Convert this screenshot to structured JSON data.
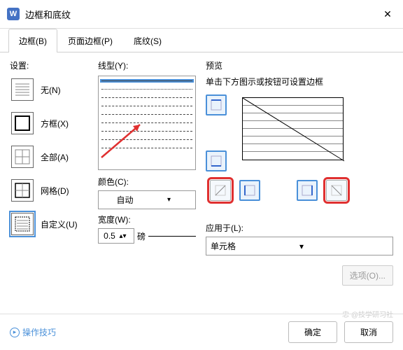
{
  "window": {
    "title": "边框和底纹",
    "app_letter": "W"
  },
  "tabs": [
    {
      "label": "边框(B)",
      "active": true
    },
    {
      "label": "页面边框(P)",
      "active": false
    },
    {
      "label": "底纹(S)",
      "active": false
    }
  ],
  "settings": {
    "label": "设置:",
    "items": [
      {
        "label": "无(N)",
        "id": "none"
      },
      {
        "label": "方框(X)",
        "id": "box"
      },
      {
        "label": "全部(A)",
        "id": "all"
      },
      {
        "label": "网格(D)",
        "id": "grid"
      },
      {
        "label": "自定义(U)",
        "id": "custom",
        "selected": true
      }
    ]
  },
  "linestyle": {
    "label": "线型(Y):"
  },
  "color": {
    "label": "颜色(C):",
    "value": "自动"
  },
  "width": {
    "label": "宽度(W):",
    "value": "0.5",
    "unit": "磅"
  },
  "preview": {
    "label": "预览",
    "hint": "单击下方图示或按钮可设置边框"
  },
  "apply": {
    "label": "应用于(L):",
    "value": "单元格"
  },
  "options_btn": "选项(O)...",
  "tips": "操作技巧",
  "ok": "确定",
  "cancel": "取消",
  "watermark": "忠 @技学研习社"
}
